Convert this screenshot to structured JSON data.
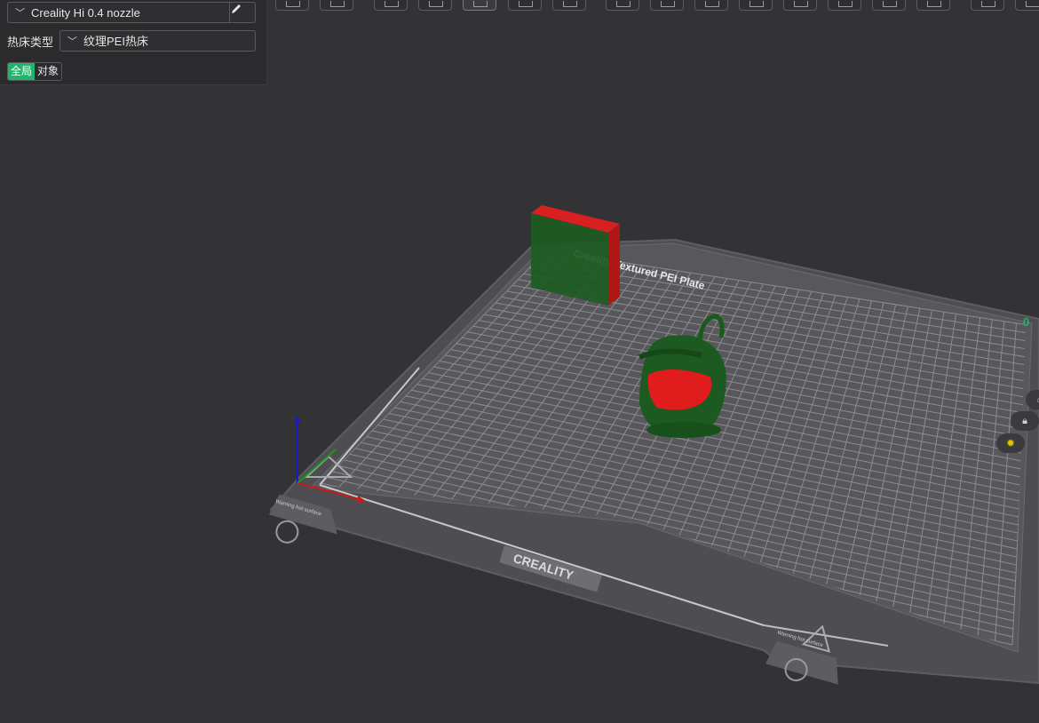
{
  "panel": {
    "printer": "Creality Hi 0.4 nozzle",
    "bed_type_label": "热床类型",
    "bed_type_value": "纹理PEI热床",
    "toggle_global": "全局",
    "toggle_object": "对象"
  },
  "plate": {
    "name_text": "Creality Textured PEI Plate",
    "brand_text": "CREALITY",
    "warning_text": "Warning hot surface"
  },
  "colors": {
    "accent": "#1fb56a",
    "object_green": "#1e5a23",
    "object_red": "#d81c1c",
    "plate": "#545458"
  },
  "toolbar": {
    "icons": [
      "add-icon",
      "arrange-icon",
      "orient-icon",
      "lay-flat-icon",
      "split-icon",
      "plate-icon",
      "move-icon",
      "rotate-icon",
      "scale-icon",
      "cut-icon",
      "support-paint-icon",
      "seam-paint-icon",
      "color-paint-icon",
      "measure-icon",
      "text-icon",
      "assembly-icon",
      "view-icon",
      "more-icon"
    ]
  },
  "side_icons": [
    "counter-indicator",
    "lock-icon",
    "gear-icon"
  ],
  "side_counter": "0"
}
